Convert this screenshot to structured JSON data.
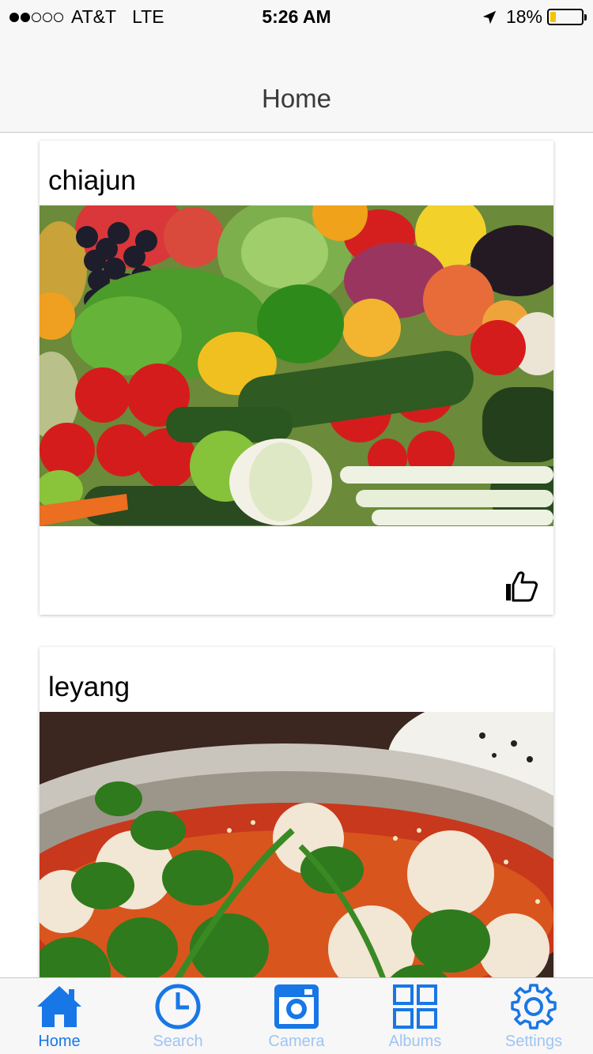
{
  "status_bar": {
    "carrier": "AT&T",
    "network": "LTE",
    "time": "5:26 AM",
    "battery_percent_label": "18%",
    "battery_level": 0.18,
    "signal_bars_filled": 2,
    "signal_bars_total": 5
  },
  "nav": {
    "title": "Home"
  },
  "posts": [
    {
      "username": "chiajun",
      "photo": "vegetables-photo",
      "like_icon": "thumbs-up-icon"
    },
    {
      "username": "leyang",
      "photo": "hot-pot-photo"
    }
  ],
  "tabs": [
    {
      "label": "Home",
      "icon": "home-icon",
      "active": true
    },
    {
      "label": "Search",
      "icon": "clock-icon",
      "active": false
    },
    {
      "label": "Camera",
      "icon": "camera-icon",
      "active": false
    },
    {
      "label": "Albums",
      "icon": "grid-icon",
      "active": false
    },
    {
      "label": "Settings",
      "icon": "gear-icon",
      "active": false
    }
  ],
  "colors": {
    "accent": "#1877e6",
    "inactive_tab": "#9fc4f4",
    "bar_background": "#f7f7f7",
    "battery_fill": "#f5c400"
  }
}
